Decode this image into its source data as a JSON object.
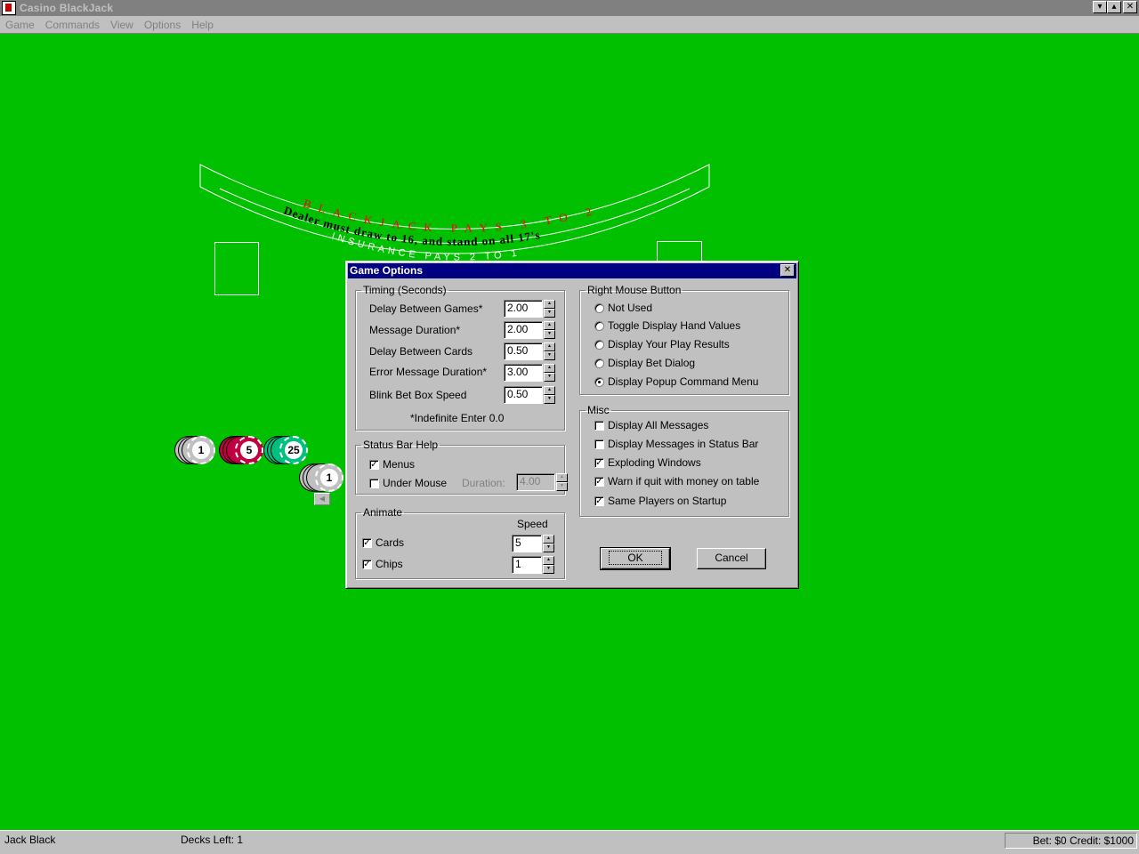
{
  "window": {
    "title": "Casino BlackJack"
  },
  "menubar": {
    "items": [
      "Game",
      "Commands",
      "View",
      "Options",
      "Help"
    ]
  },
  "table": {
    "arc_top": "BLACKJACK PAYS 3 TO 2",
    "arc_middle": "Dealer must draw to 16, and stand on all 17's",
    "arc_bottom": "INSURANCE PAYS 2 TO 1",
    "accent_color": "#ff0000"
  },
  "chips": [
    {
      "value": "1",
      "color": "#c0c0c0"
    },
    {
      "value": "5",
      "color": "#c00040"
    },
    {
      "value": "25",
      "color": "#00c080"
    },
    {
      "value": "1",
      "color": "#c0c0c0"
    }
  ],
  "dialog": {
    "title": "Game Options",
    "timing": {
      "legend": "Timing (Seconds)",
      "rows": [
        {
          "label": "Delay Between Games*",
          "value": "2.00"
        },
        {
          "label": "Message Duration*",
          "value": "2.00"
        },
        {
          "label": "Delay Between Cards",
          "value": "0.50"
        },
        {
          "label": "Error Message Duration*",
          "value": "3.00"
        },
        {
          "label": "Blink Bet Box Speed",
          "value": "0.50"
        }
      ],
      "note": "*Indefinite Enter 0.0"
    },
    "status_help": {
      "legend": "Status Bar Help",
      "menus": {
        "label": "Menus",
        "checked": true
      },
      "under_mouse": {
        "label": "Under Mouse",
        "checked": false
      },
      "duration_label": "Duration:",
      "duration_value": "4.00"
    },
    "animate": {
      "legend": "Animate",
      "speed_header": "Speed",
      "cards": {
        "label": "Cards",
        "checked": true,
        "speed": "5"
      },
      "chips": {
        "label": "Chips",
        "checked": true,
        "speed": "1"
      }
    },
    "right_mouse": {
      "legend": "Right Mouse Button",
      "options": [
        {
          "label": "Not Used",
          "selected": false
        },
        {
          "label": "Toggle Display Hand Values",
          "selected": false
        },
        {
          "label": "Display Your Play Results",
          "selected": false
        },
        {
          "label": "Display Bet Dialog",
          "selected": false
        },
        {
          "label": "Display Popup Command Menu",
          "selected": true
        }
      ]
    },
    "misc": {
      "legend": "Misc",
      "options": [
        {
          "label": "Display All Messages",
          "checked": false
        },
        {
          "label": "Display Messages in Status Bar",
          "checked": false
        },
        {
          "label": "Exploding Windows",
          "checked": true
        },
        {
          "label": "Warn if quit with money on table",
          "checked": true
        },
        {
          "label": "Same Players on Startup",
          "checked": true
        }
      ]
    },
    "ok_label": "OK",
    "cancel_label": "Cancel"
  },
  "statusbar": {
    "player": "Jack Black",
    "decks": "Decks Left: 1",
    "money": "Bet: $0  Credit: $1000"
  }
}
